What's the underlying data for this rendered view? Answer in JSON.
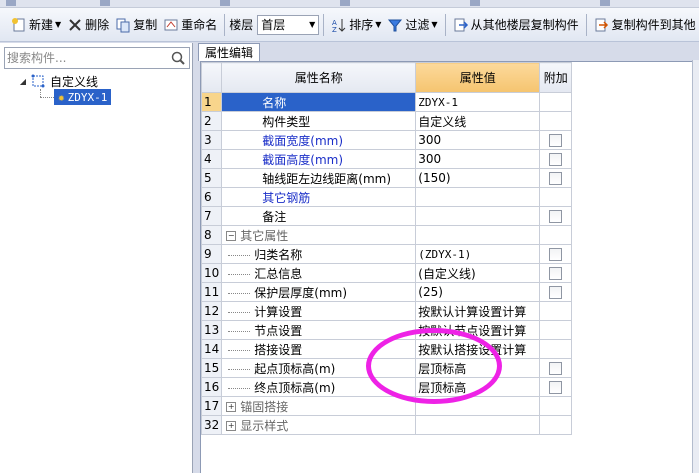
{
  "toolbar": {
    "new_label": "新建",
    "delete_label": "删除",
    "copy_label": "复制",
    "rename_label": "重命名",
    "floor_label": "楼层",
    "floor_value": "首层",
    "sort_label": "排序",
    "filter_label": "过滤",
    "copy_from_floor_label": "从其他楼层复制构件",
    "copy_to_other_label": "复制构件到其他"
  },
  "search": {
    "placeholder": "搜索构件..."
  },
  "tree": {
    "root_label": "自定义线",
    "selected_item": "ZDYX-1"
  },
  "tab_label": "属性编辑",
  "grid": {
    "headers": {
      "name": "属性名称",
      "value": "属性值",
      "extra": "附加"
    },
    "rows": [
      {
        "num": "1",
        "name": "名称",
        "value": "ZDYX-1"
      },
      {
        "num": "2",
        "name": "构件类型",
        "value": "自定义线"
      },
      {
        "num": "3",
        "name": "截面宽度(mm)",
        "value": "300"
      },
      {
        "num": "4",
        "name": "截面高度(mm)",
        "value": "300"
      },
      {
        "num": "5",
        "name": "轴线距左边线距离(mm)",
        "value": "(150)"
      },
      {
        "num": "6",
        "name": "其它钢筋",
        "value": ""
      },
      {
        "num": "7",
        "name": "备注",
        "value": ""
      },
      {
        "num": "8",
        "name": "其它属性",
        "value": ""
      },
      {
        "num": "9",
        "name": "归类名称",
        "value": "(ZDYX-1)"
      },
      {
        "num": "10",
        "name": "汇总信息",
        "value": "(自定义线)"
      },
      {
        "num": "11",
        "name": "保护层厚度(mm)",
        "value": "(25)"
      },
      {
        "num": "12",
        "name": "计算设置",
        "value": "按默认计算设置计算"
      },
      {
        "num": "13",
        "name": "节点设置",
        "value": "按默认节点设置计算"
      },
      {
        "num": "14",
        "name": "搭接设置",
        "value": "按默认搭接设置计算"
      },
      {
        "num": "15",
        "name": "起点顶标高(m)",
        "value": "层顶标高"
      },
      {
        "num": "16",
        "name": "终点顶标高(m)",
        "value": "层顶标高"
      },
      {
        "num": "17",
        "name": "锚固搭接",
        "value": ""
      },
      {
        "num": "32",
        "name": "显示样式",
        "value": ""
      }
    ]
  },
  "colors": {
    "selection": "#2a62c9",
    "header_value_bg": "#f5c46f",
    "annotation": "#ee22e6",
    "blue_text": "#1a2ec8"
  }
}
